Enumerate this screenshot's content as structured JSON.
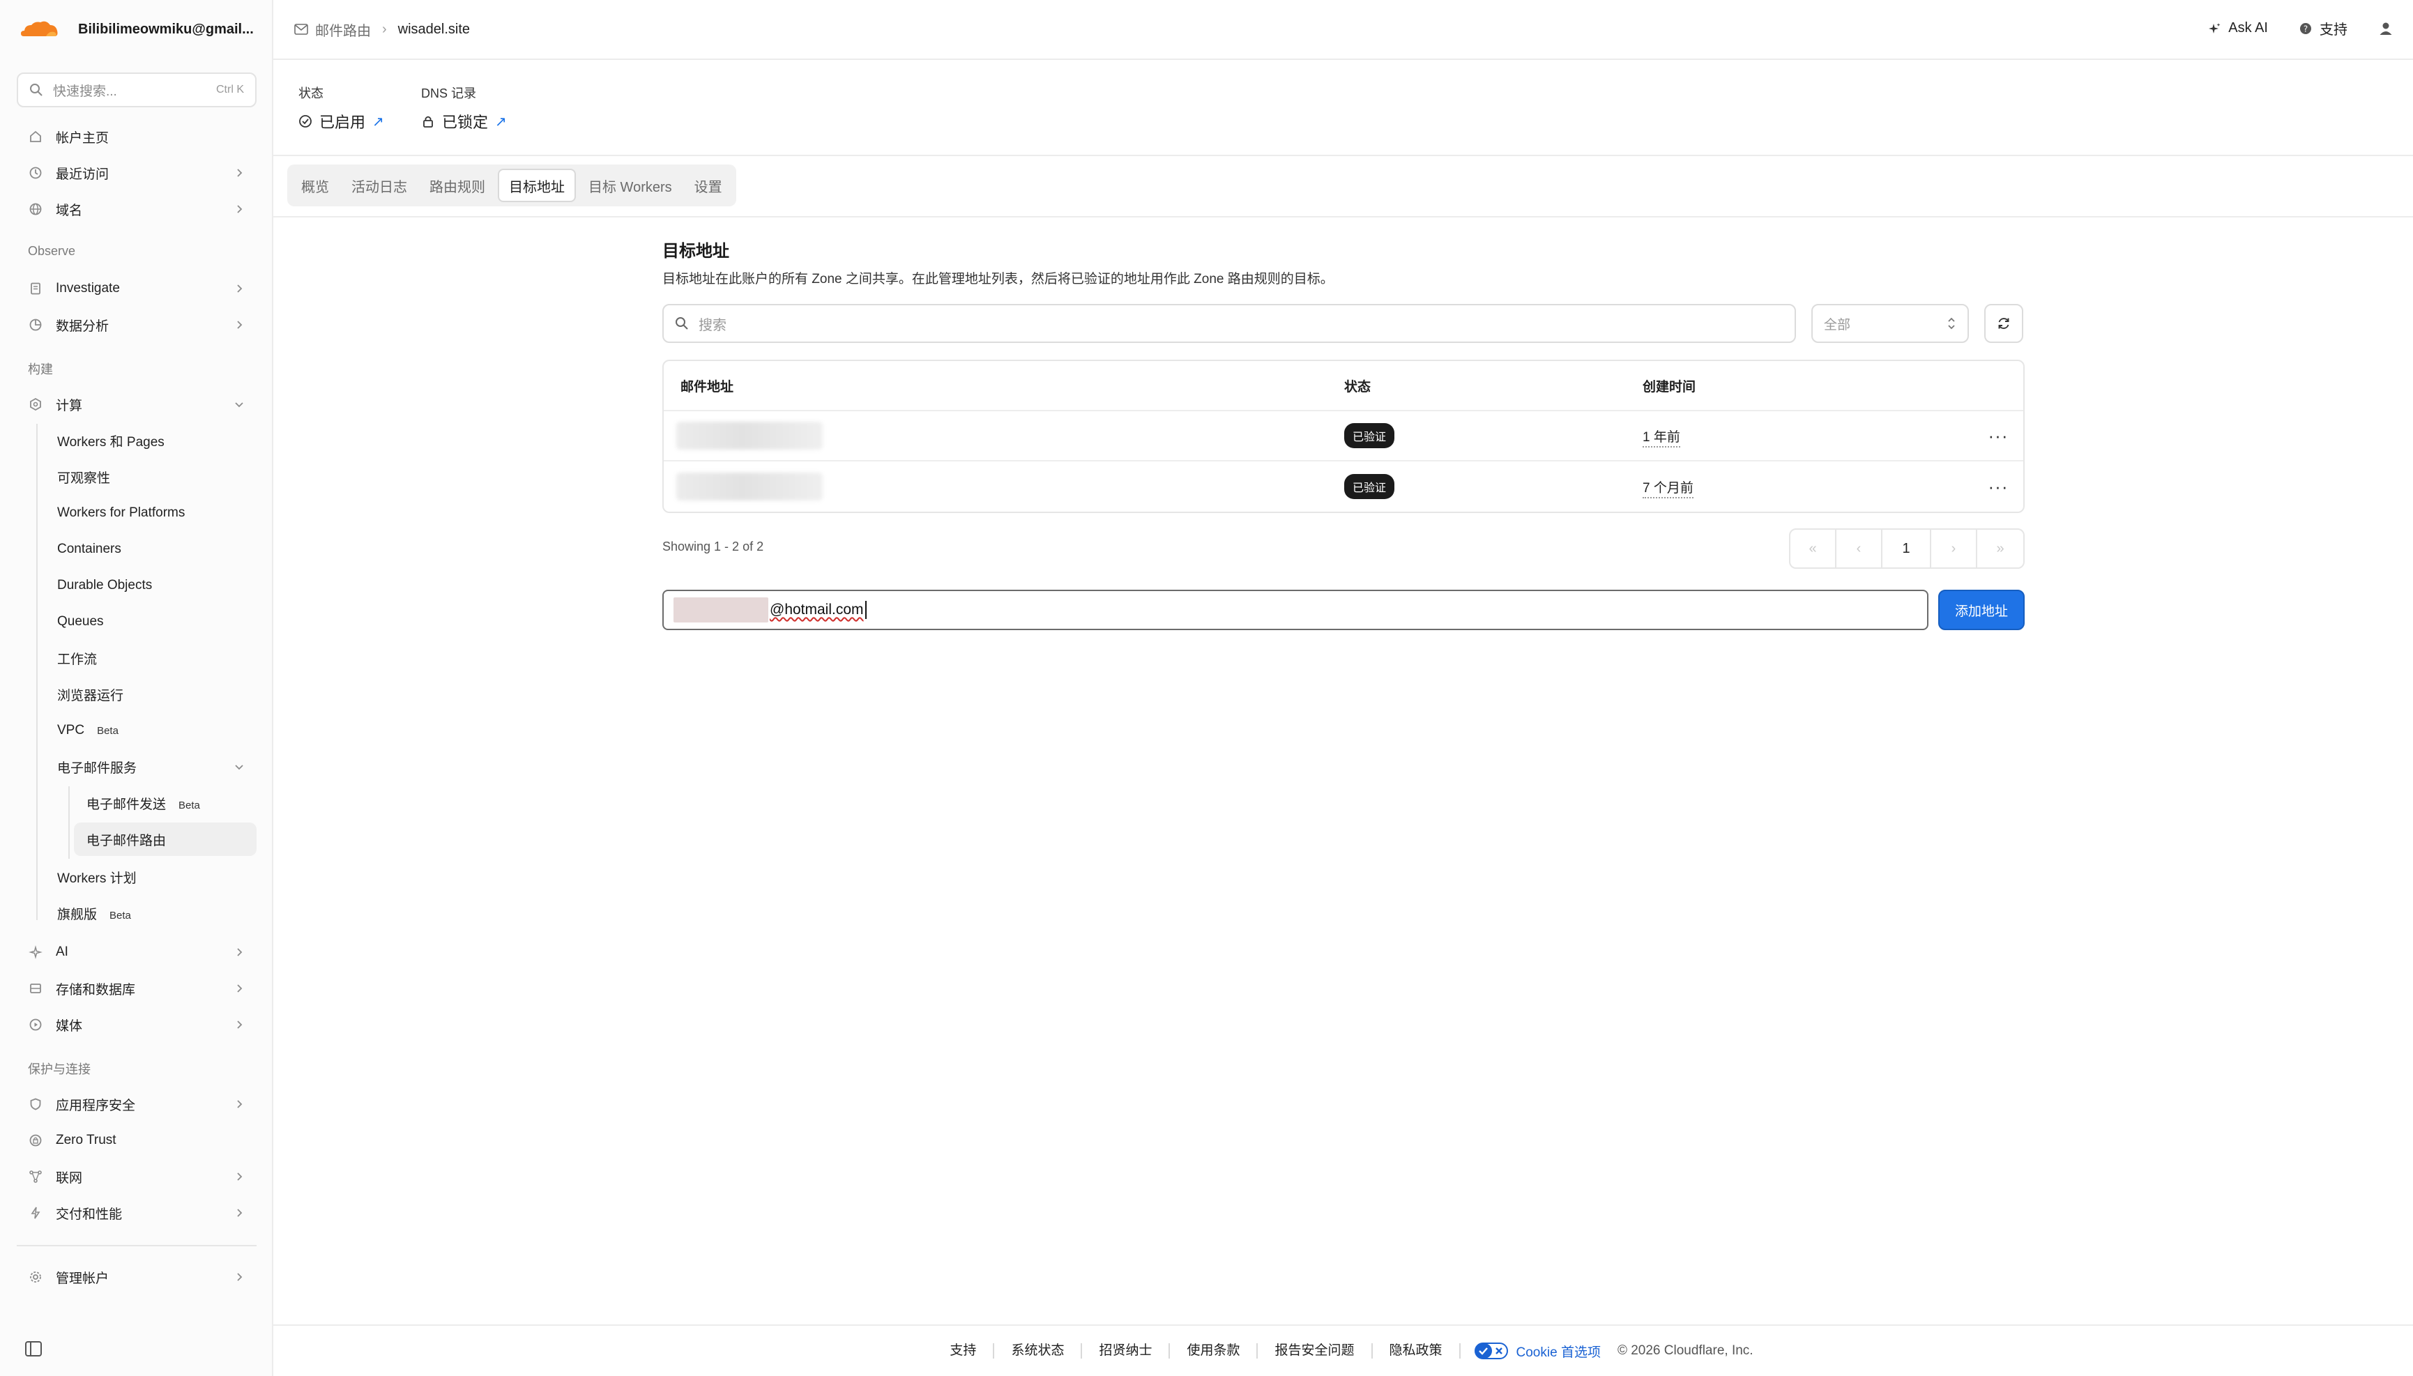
{
  "account": {
    "name": "Bilibilimeowmiku@gmail..."
  },
  "sidebar": {
    "search_placeholder": "快速搜索...",
    "search_shortcut": "Ctrl K",
    "items": [
      {
        "label": "帐户主页"
      },
      {
        "label": "最近访问"
      },
      {
        "label": "域名"
      },
      {
        "label": "Investigate"
      },
      {
        "label": "数据分析"
      },
      {
        "label": "计算"
      },
      {
        "label": "Workers 和 Pages"
      },
      {
        "label": "可观察性"
      },
      {
        "label": "Workers for Platforms"
      },
      {
        "label": "Containers"
      },
      {
        "label": "Durable Objects"
      },
      {
        "label": "Queues"
      },
      {
        "label": "工作流"
      },
      {
        "label": "浏览器运行"
      },
      {
        "label": "VPC",
        "badge": "Beta"
      },
      {
        "label": "电子邮件服务"
      },
      {
        "label": "电子邮件发送",
        "badge": "Beta"
      },
      {
        "label": "电子邮件路由"
      },
      {
        "label": "Workers 计划"
      },
      {
        "label": "旗舰版",
        "badge": "Beta"
      },
      {
        "label": "AI"
      },
      {
        "label": "存储和数据库"
      },
      {
        "label": "媒体"
      },
      {
        "label": "应用程序安全"
      },
      {
        "label": "Zero Trust"
      },
      {
        "label": "联网"
      },
      {
        "label": "交付和性能"
      },
      {
        "label": "管理帐户"
      }
    ],
    "sections": {
      "observe": "Observe",
      "build": "构建",
      "protect": "保护与连接"
    }
  },
  "header": {
    "breadcrumb": [
      "邮件路由",
      "wisadel.site"
    ],
    "ask_ai": "Ask AI",
    "support": "支持"
  },
  "status": {
    "state_label": "状态",
    "state_value": "已启用",
    "dns_label": "DNS 记录",
    "dns_value": "已锁定"
  },
  "tabs": [
    "概览",
    "活动日志",
    "路由规则",
    "目标地址",
    "目标 Workers",
    "设置"
  ],
  "main": {
    "title": "目标地址",
    "description": "目标地址在此账户的所有 Zone 之间共享。在此管理地址列表，然后将已验证的地址用作此 Zone 路由规则的目标。",
    "search_placeholder": "搜索",
    "filter_value": "全部",
    "columns": [
      "邮件地址",
      "状态",
      "创建时间"
    ],
    "rows": [
      {
        "status": "已验证",
        "created": "1 年前"
      },
      {
        "status": "已验证",
        "created": "7 个月前"
      }
    ],
    "showing": "Showing 1 - 2 of 2",
    "current_page": "1",
    "add_input_value": "@hotmail.com",
    "add_button": "添加地址"
  },
  "footer": {
    "links": [
      "支持",
      "系统状态",
      "招贤纳士",
      "使用条款",
      "报告安全问题",
      "隐私政策"
    ],
    "cookie": "Cookie 首选项",
    "copyright": "© 2026 Cloudflare, Inc."
  },
  "colors": {
    "accent": "#1f73e6",
    "brand": "#f48120"
  }
}
